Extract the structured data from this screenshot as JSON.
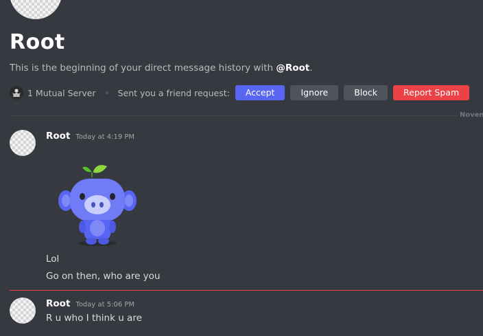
{
  "profile": {
    "name": "Root",
    "intro_prefix": "This is the beginning of your direct message history with ",
    "intro_mention": "@Root",
    "intro_suffix": ".",
    "mutual_servers": "1 Mutual Server",
    "friend_request_text": "Sent you a friend request:"
  },
  "actions": {
    "accept": "Accept",
    "ignore": "Ignore",
    "block": "Block",
    "report_spam": "Report Spam"
  },
  "divider": {
    "date_label": "Novemb"
  },
  "messages": [
    {
      "author": "Root",
      "timestamp": "Today at 4:19 PM",
      "sticker": "blue-wumpus-sticker",
      "lines": [
        "Lol",
        "Go on then, who are you"
      ]
    },
    {
      "author": "Root",
      "timestamp": "Today at 5:06 PM",
      "lines": [
        "R u who I think u are"
      ]
    }
  ],
  "colors": {
    "background": "#36393f",
    "accept": "#5865f2",
    "neutral_button": "#4f545c",
    "danger": "#ed4245",
    "new_messages_line": "#ed4245"
  }
}
